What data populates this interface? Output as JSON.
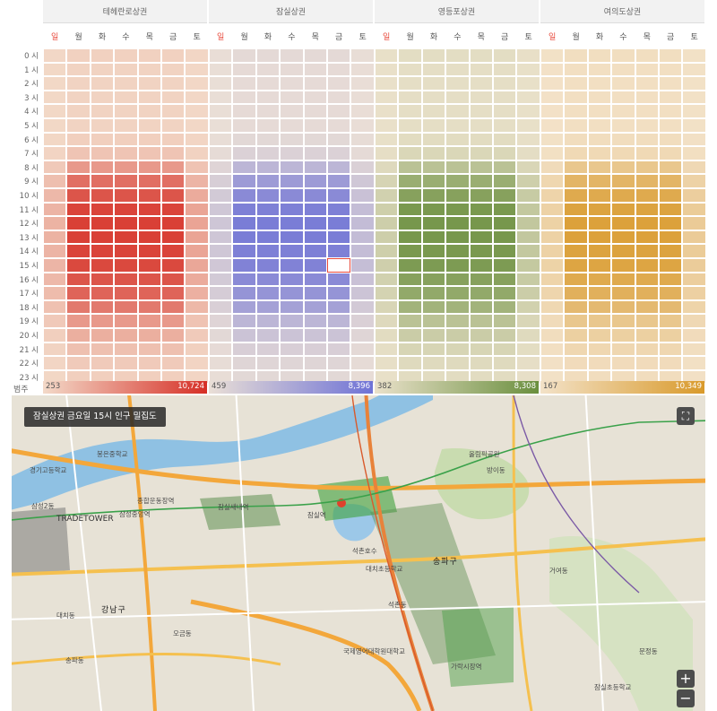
{
  "areas": [
    {
      "name": "테헤란로상권",
      "color": "#d62f26",
      "min": "253",
      "max": "10,724"
    },
    {
      "name": "잠실상권",
      "color": "#6e72d6",
      "min": "459",
      "max": "8,396"
    },
    {
      "name": "영등포상권",
      "color": "#6a8f3e",
      "min": "382",
      "max": "8,308"
    },
    {
      "name": "여의도상권",
      "color": "#d99a2b",
      "min": "167",
      "max": "10,349"
    }
  ],
  "days": [
    "일",
    "월",
    "화",
    "수",
    "목",
    "금",
    "토"
  ],
  "hours": [
    "0 시",
    "1 시",
    "2 시",
    "3 시",
    "4 시",
    "5 시",
    "6 시",
    "7 시",
    "8 시",
    "9 시",
    "10 시",
    "11 시",
    "12 시",
    "13 시",
    "14 시",
    "15 시",
    "16 시",
    "17 시",
    "18 시",
    "19 시",
    "20 시",
    "21 시",
    "22 시",
    "23 시"
  ],
  "hour_profile": [
    0.04,
    0.03,
    0.03,
    0.03,
    0.03,
    0.03,
    0.05,
    0.1,
    0.3,
    0.5,
    0.62,
    0.7,
    0.72,
    0.72,
    0.7,
    0.68,
    0.62,
    0.55,
    0.45,
    0.3,
    0.2,
    0.12,
    0.07,
    0.05
  ],
  "weekday_factor": [
    0.25,
    1,
    1,
    1,
    1,
    1,
    0.35
  ],
  "selected_cell": {
    "area": 1,
    "day": 5,
    "hour": 15
  },
  "legend_label": "범주",
  "map": {
    "title": "잠실상권 금요일 15시 인구 밀집도",
    "fullscreen_icon": "fullscreen-icon",
    "zoom_in": "+",
    "zoom_out": "−",
    "places": [
      {
        "t": "삼성2동",
        "cls": ""
      },
      {
        "t": "TRADETOWER",
        "cls": "big"
      },
      {
        "t": "봉은중학교",
        "cls": ""
      },
      {
        "t": "경기고등학교",
        "cls": ""
      },
      {
        "t": "삼성중앙역",
        "cls": ""
      },
      {
        "t": "종합운동장역",
        "cls": ""
      },
      {
        "t": "잠실새내역",
        "cls": ""
      },
      {
        "t": "잠실역",
        "cls": ""
      },
      {
        "t": "석촌호수",
        "cls": ""
      },
      {
        "t": "송파구",
        "cls": "area"
      },
      {
        "t": "강남구",
        "cls": "area"
      },
      {
        "t": "방이동",
        "cls": ""
      },
      {
        "t": "가락시장역",
        "cls": ""
      },
      {
        "t": "대치동",
        "cls": ""
      },
      {
        "t": "올림픽공원",
        "cls": ""
      },
      {
        "t": "국제영어대학원대학교",
        "cls": ""
      },
      {
        "t": "잠실초등학교",
        "cls": ""
      },
      {
        "t": "문정동",
        "cls": ""
      },
      {
        "t": "거여동",
        "cls": ""
      },
      {
        "t": "오금동",
        "cls": ""
      },
      {
        "t": "대치초등학교",
        "cls": ""
      },
      {
        "t": "석촌동",
        "cls": ""
      },
      {
        "t": "송파동",
        "cls": ""
      },
      {
        "t": "대치동",
        "cls": ""
      }
    ]
  }
}
